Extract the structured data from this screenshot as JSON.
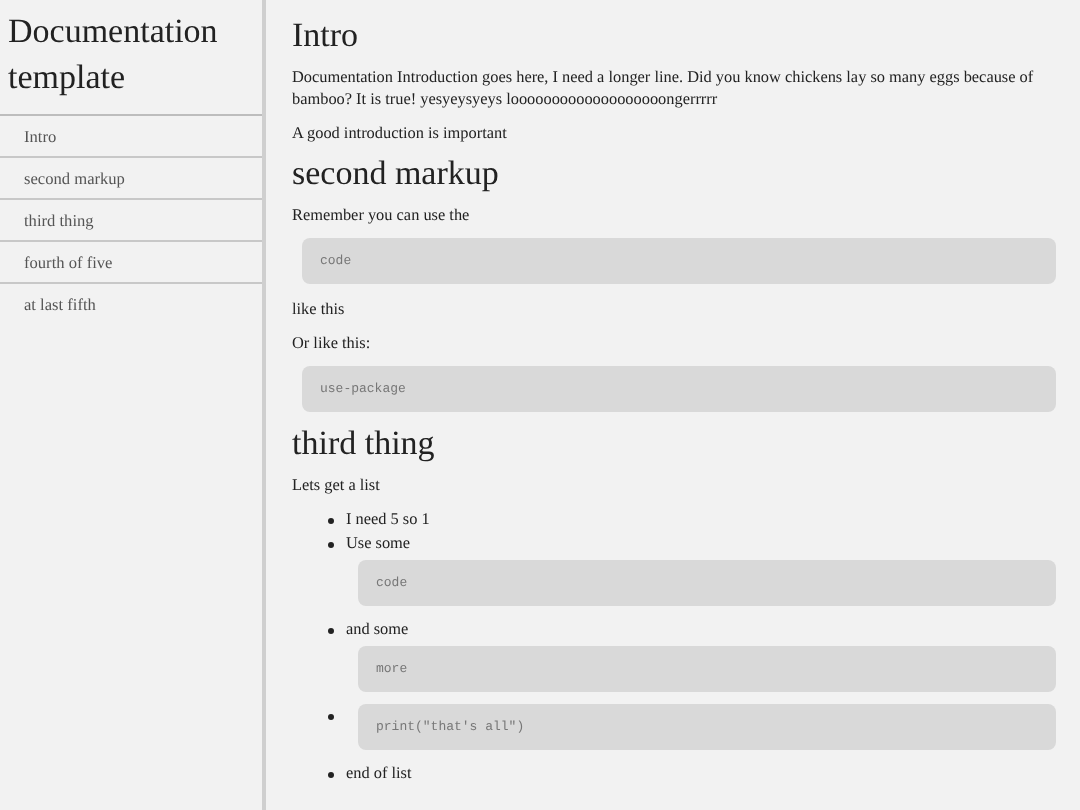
{
  "sidebar": {
    "title": "Documentation template",
    "items": [
      {
        "label": "Intro"
      },
      {
        "label": "second markup"
      },
      {
        "label": "third thing"
      },
      {
        "label": "fourth of five"
      },
      {
        "label": "at last fifth"
      }
    ]
  },
  "content": [
    {
      "kind": "heading",
      "text": "Intro"
    },
    {
      "kind": "paragraph",
      "text": "Documentation Introduction goes here, I need a longer line. Did you know chickens lay so many eggs because of bamboo? It is true! yesyeysyeys looooooooooooooooooongerrrrr"
    },
    {
      "kind": "paragraph",
      "text": "A good introduction is important"
    },
    {
      "kind": "heading",
      "text": "second markup"
    },
    {
      "kind": "paragraph",
      "text": "Remember you can use the"
    },
    {
      "kind": "code",
      "text": "code"
    },
    {
      "kind": "paragraph",
      "text": "like this"
    },
    {
      "kind": "paragraph",
      "text": "Or like this:"
    },
    {
      "kind": "code",
      "text": "use-package"
    },
    {
      "kind": "heading",
      "text": "third thing"
    },
    {
      "kind": "paragraph",
      "text": "Lets get a list"
    },
    {
      "kind": "list",
      "items": [
        {
          "text": "I need 5 so 1"
        },
        {
          "text": "Use some",
          "code": "code"
        },
        {
          "text": "and some",
          "code": "more"
        },
        {
          "code": "print(\"that's all\")"
        },
        {
          "text": "end of list"
        }
      ]
    }
  ]
}
